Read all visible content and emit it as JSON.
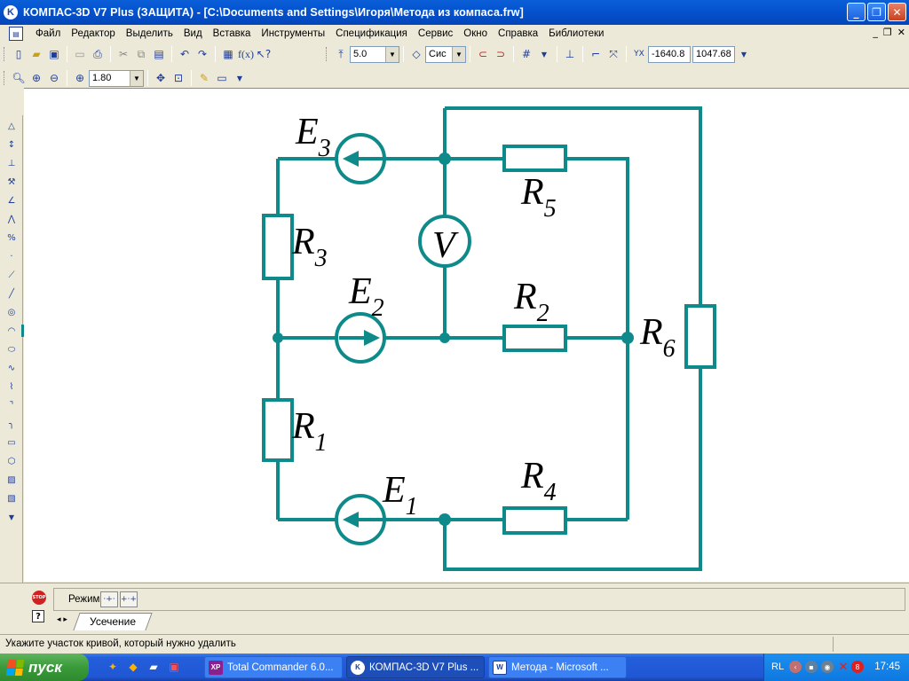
{
  "window": {
    "title": "КОМПАС-3D V7 Plus (ЗАЩИТА) - [C:\\Documents and Settings\\Игоря\\Метода из компаса.frw]",
    "logo_text": "K",
    "buttons": {
      "minimize": "_",
      "maximize": "❐",
      "close": "✕"
    }
  },
  "menu": {
    "items": [
      "Файл",
      "Редактор",
      "Выделить",
      "Вид",
      "Вставка",
      "Инструменты",
      "Спецификация",
      "Сервис",
      "Окно",
      "Справка",
      "Библиотеки"
    ],
    "mdi_buttons": {
      "minimize": "_",
      "restore": "❐",
      "close": "✕"
    }
  },
  "toolbar_std": {
    "step_value": "5.0",
    "style_value": "Сис",
    "coord_x": "-1640.8",
    "coord_y": "1047.68"
  },
  "toolbar_view": {
    "zoom_value": "1.80"
  },
  "drawing": {
    "labels": {
      "E3": {
        "letter": "E",
        "sub": "3"
      },
      "E2": {
        "letter": "E",
        "sub": "2"
      },
      "E1": {
        "letter": "E",
        "sub": "1"
      },
      "R1": {
        "letter": "R",
        "sub": "1"
      },
      "R2": {
        "letter": "R",
        "sub": "2"
      },
      "R3": {
        "letter": "R",
        "sub": "3"
      },
      "R4": {
        "letter": "R",
        "sub": "4"
      },
      "R5": {
        "letter": "R",
        "sub": "5"
      },
      "R6": {
        "letter": "R",
        "sub": "6"
      },
      "V": "V"
    },
    "wire_color": "#0E8A8A"
  },
  "panel": {
    "mode_label": "Режим",
    "tab_label": "Усечение",
    "stop_text": "STOP",
    "help_text": "?"
  },
  "status": {
    "message": "Укажите участок кривой, который нужно удалить"
  },
  "taskbar": {
    "start_label": "пуск",
    "tasks": [
      {
        "label": "Total Commander 6.0...",
        "icon": "total-commander-icon"
      },
      {
        "label": "КОМПАС-3D V7 Plus ...",
        "icon": "kompas-icon"
      },
      {
        "label": "Метода - Microsoft ...",
        "icon": "word-icon"
      }
    ],
    "tray_lang": "RL",
    "clock": "17:45"
  }
}
